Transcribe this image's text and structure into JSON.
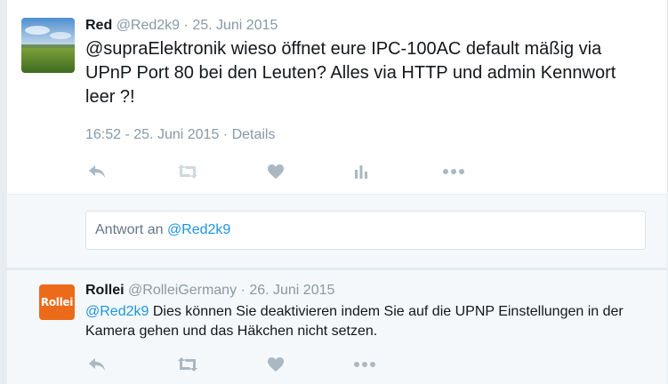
{
  "tweet": {
    "author_name": "Red",
    "author_handle": "@Red2k9",
    "date_sep": "·",
    "date": "25. Juni 2015",
    "text": "@supraElektronik wieso öffnet eure IPC-100AC default mäßig via UPnP Port 80 bei den Leuten? Alles via HTTP und admin Kennwort leer ?!",
    "timestamp": "16:52 - 25. Juni 2015",
    "meta_sep": "·",
    "details_link": "Details"
  },
  "reply_box": {
    "prefix": "Antwort an",
    "mention": "@Red2k9"
  },
  "reply": {
    "author_name": "Rollei",
    "author_handle": "@RolleiGermany",
    "date_sep": "·",
    "date": "26. Juni 2015",
    "avatar_text": "Rollei",
    "mention": "@Red2k9",
    "text": " Dies können Sie deaktivieren indem Sie auf die UPNP Einstellungen in der Kamera gehen und das Häkchen nicht setzen."
  },
  "icons": [
    "reply-icon",
    "retweet-icon",
    "like-icon",
    "analytics-icon",
    "more-icon"
  ],
  "colors": {
    "muted": "#8899a6",
    "link": "#1b95e0",
    "background": "#e6ecf0",
    "rollei_orange": "#ec6b1b"
  }
}
